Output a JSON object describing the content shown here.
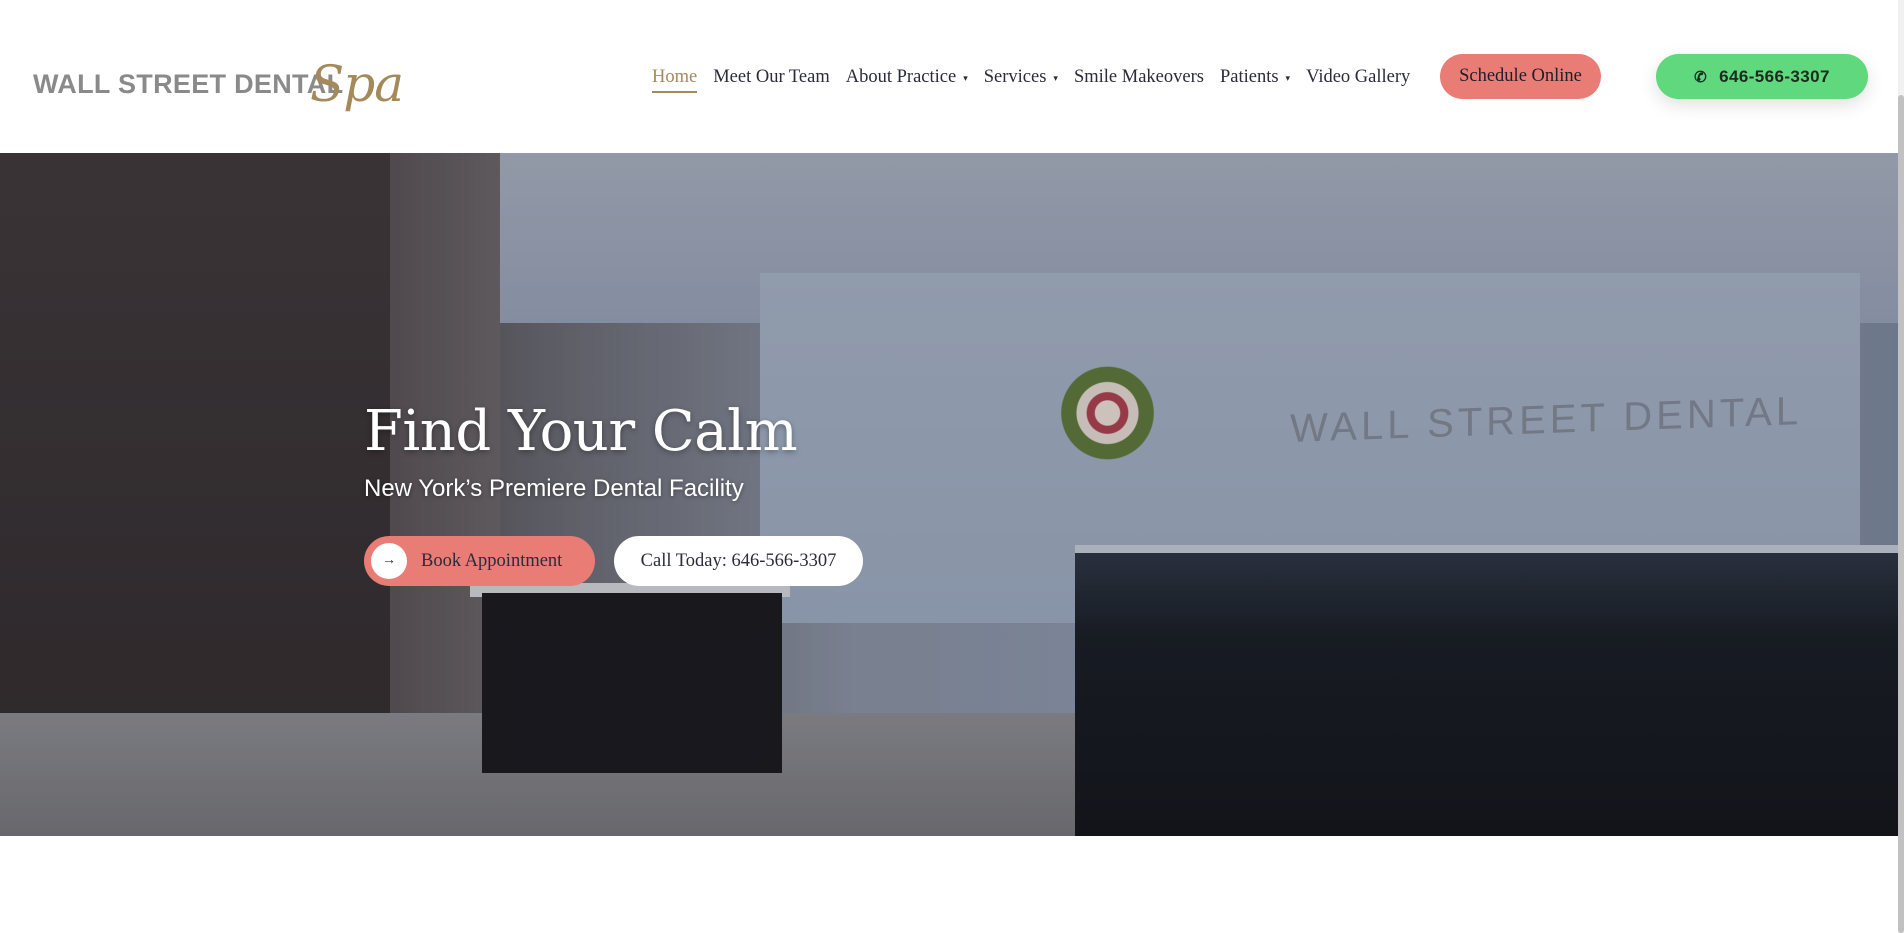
{
  "header": {
    "logo_wordmark": "WALL STREET DENTAL",
    "logo_script": "Spa",
    "nav": [
      {
        "label": "Home",
        "active": true,
        "dropdown": false
      },
      {
        "label": "Meet Our Team",
        "active": false,
        "dropdown": false
      },
      {
        "label": "About Practice",
        "active": false,
        "dropdown": true
      },
      {
        "label": "Services",
        "active": false,
        "dropdown": true
      },
      {
        "label": "Smile Makeovers",
        "active": false,
        "dropdown": false
      },
      {
        "label": "Patients",
        "active": false,
        "dropdown": true
      },
      {
        "label": "Video Gallery",
        "active": false,
        "dropdown": false
      }
    ],
    "schedule_label": "Schedule Online",
    "phone_label": "646-566-3307"
  },
  "hero": {
    "title": "Find Your Calm",
    "subtitle": "New York’s Premiere Dental Facility",
    "book_label": "Book Appointment",
    "call_label": "Call Today: 646-566-3307",
    "background_sign": "WALL STREET DENTAL"
  },
  "icons": {
    "caret": "▾",
    "arrow": "→",
    "phone": "✆"
  },
  "colors": {
    "accent_gold": "#a48a5b",
    "coral": "#e97d75",
    "green": "#5fd87e",
    "text_dark": "#2b2b3a"
  }
}
